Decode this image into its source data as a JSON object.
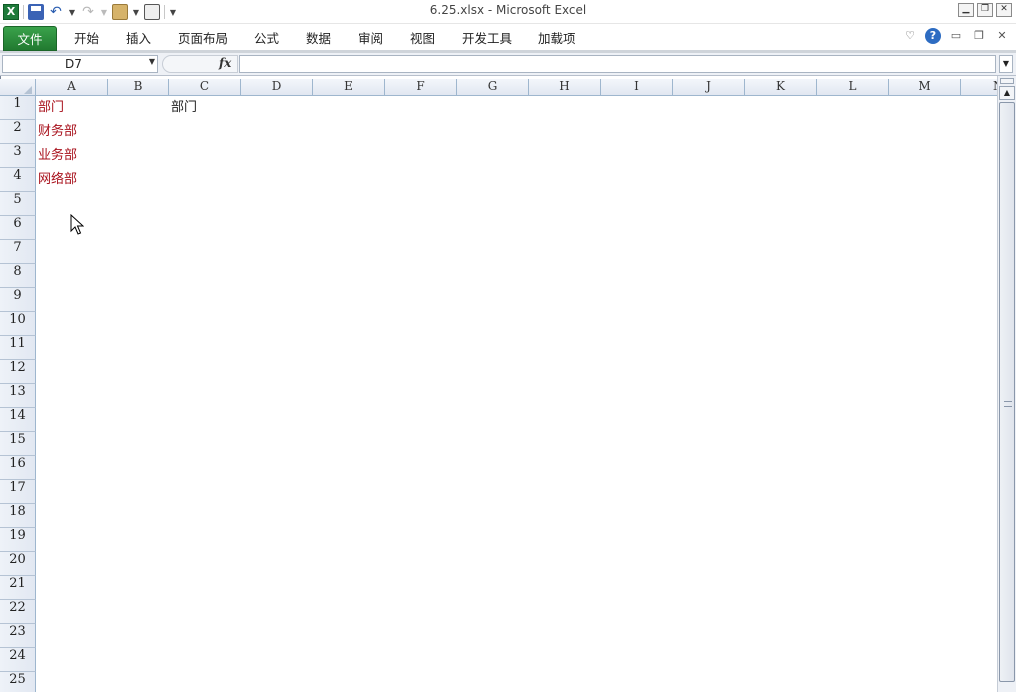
{
  "window": {
    "title": "6.25.xlsx - Microsoft Excel"
  },
  "qat": {
    "app_icon": "X"
  },
  "ribbon": {
    "tabs": [
      "文件",
      "开始",
      "插入",
      "页面布局",
      "公式",
      "数据",
      "审阅",
      "视图",
      "开发工具",
      "加载项"
    ],
    "help": "?"
  },
  "formula_bar": {
    "name_box": "D7",
    "fx": "fx",
    "formula": ""
  },
  "grid": {
    "columns": [
      "A",
      "B",
      "C",
      "D",
      "E",
      "F",
      "G",
      "H",
      "I",
      "J",
      "K",
      "L",
      "M",
      "N"
    ],
    "rows": [
      "1",
      "2",
      "3",
      "4",
      "5",
      "6",
      "7",
      "8",
      "9",
      "10",
      "11",
      "12",
      "13",
      "14",
      "15",
      "16",
      "17",
      "18",
      "19",
      "20",
      "21",
      "22",
      "23",
      "24",
      "25"
    ],
    "cells": {
      "A1": "部门",
      "A2": "财务部",
      "A3": "业务部",
      "A4": "网络部",
      "C1": "部门"
    },
    "red_text_color": "#a8101b"
  }
}
